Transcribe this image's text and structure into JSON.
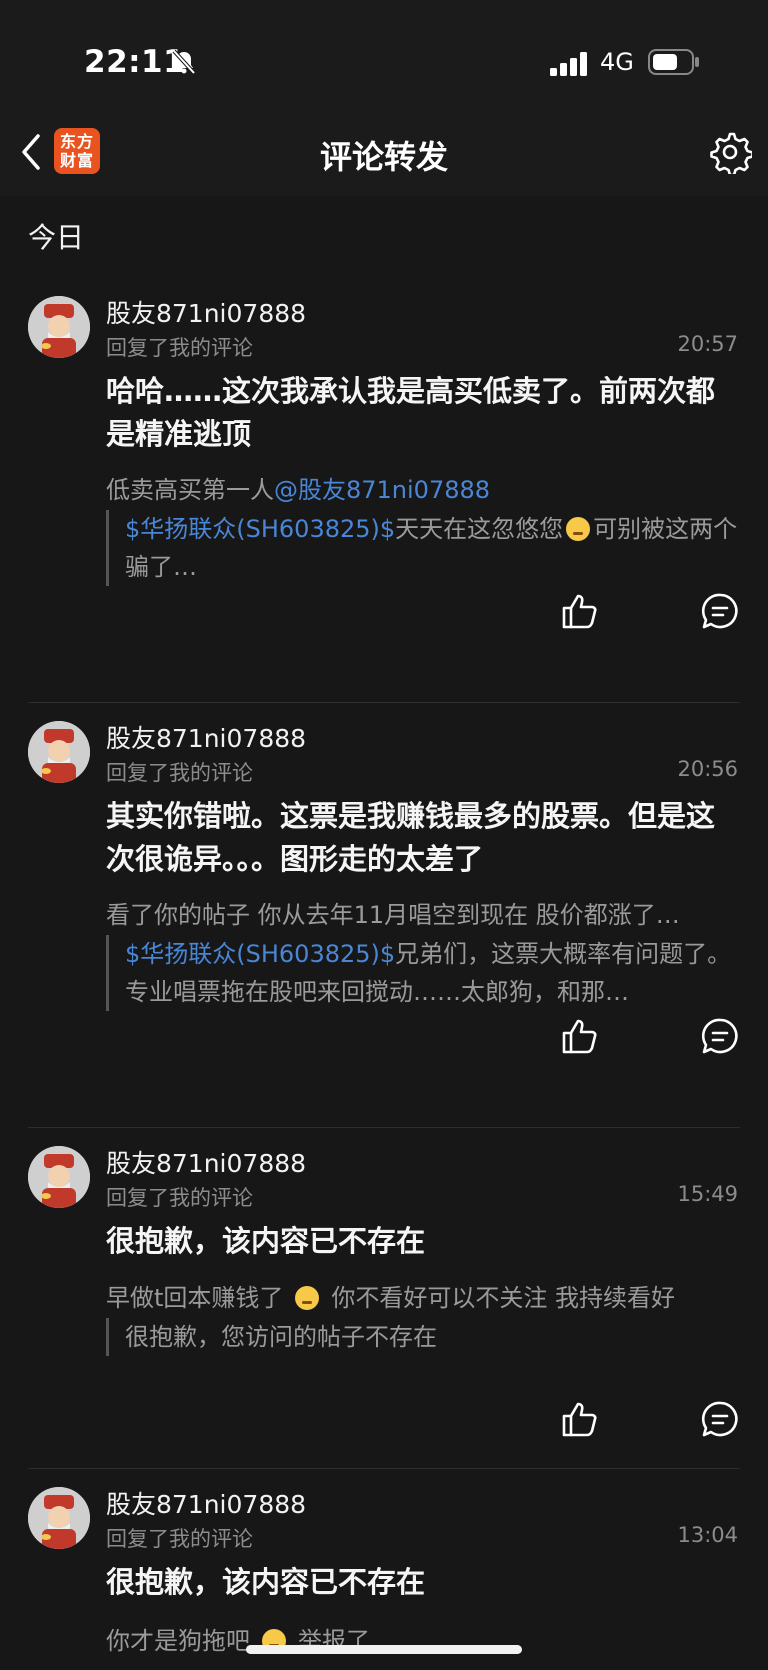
{
  "status_bar": {
    "time": "22:11",
    "network": "4G"
  },
  "nav": {
    "logo_text_1": "东方",
    "logo_text_2": "财富",
    "title": "评论转发"
  },
  "section": {
    "header": "今日"
  },
  "items": [
    {
      "username": "股友871ni07888",
      "action": "回复了我的评论",
      "time": "20:57",
      "reply": "哈哈……这次我承认我是高买低卖了。前两次都是精准逃顶",
      "orig_text": "低卖高买第一人",
      "orig_mention": "@股友871ni07888",
      "quote_stock": "$华扬联众(SH603825)$",
      "quote_text_a": "天天在这忽悠您",
      "quote_text_b": "可别被这两个骗了…"
    },
    {
      "username": "股友871ni07888",
      "action": "回复了我的评论",
      "time": "20:56",
      "reply": "其实你错啦。这票是我赚钱最多的股票。但是这次很诡异。。。图形走的太差了",
      "orig_text": "看了你的帖子 你从去年11月唱空到现在 股价都涨了…",
      "quote_stock": "$华扬联众(SH603825)$",
      "quote_text_a": "兄弟们，这票大概率有问题了。专业唱票拖在股吧来回搅动……太郎狗，和那…"
    },
    {
      "username": "股友871ni07888",
      "action": "回复了我的评论",
      "time": "15:49",
      "reply": "很抱歉，该内容已不存在",
      "orig_text_a": "早做t回本赚钱了",
      "orig_text_b": "你不看好可以不关注 我持续看好",
      "quote_text_a": "很抱歉，您访问的帖子不存在"
    },
    {
      "username": "股友871ni07888",
      "action": "回复了我的评论",
      "time": "13:04",
      "reply": "很抱歉，该内容已不存在",
      "orig_text_a": "你才是狗拖吧",
      "orig_text_b": "举报了"
    }
  ],
  "colors": {
    "background": "#171717",
    "link": "#4a86d6",
    "brand": "#e9531f"
  },
  "icons": [
    "bell-muted-icon",
    "signal-icon",
    "battery-icon",
    "back-icon",
    "gear-icon",
    "like-icon",
    "comment-icon",
    "avatar-icon",
    "emoji-icon"
  ]
}
